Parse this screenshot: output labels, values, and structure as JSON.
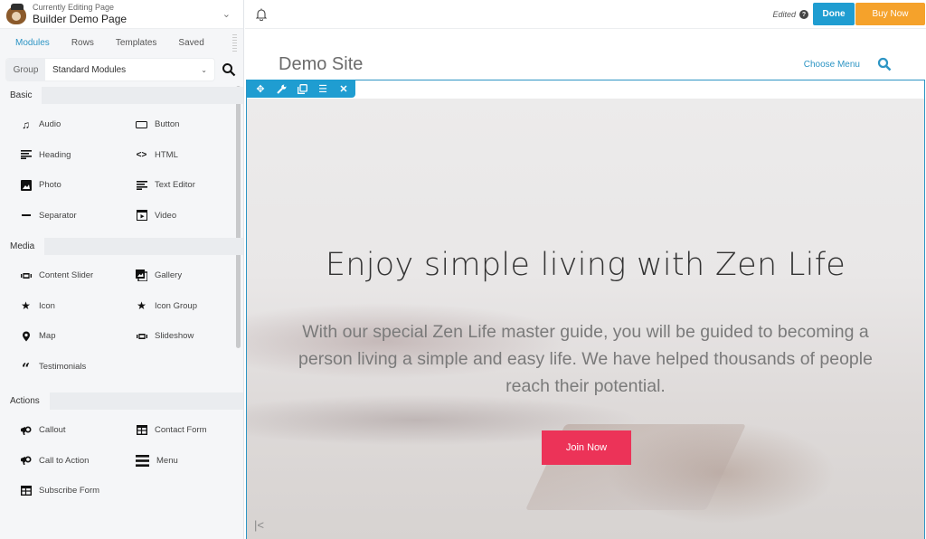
{
  "sidebar": {
    "header": {
      "subtitle": "Currently Editing Page",
      "title": "Builder Demo Page"
    },
    "tabs": [
      {
        "label": "Modules",
        "active": true
      },
      {
        "label": "Rows",
        "active": false
      },
      {
        "label": "Templates",
        "active": false
      },
      {
        "label": "Saved",
        "active": false
      }
    ],
    "group": {
      "label": "Group",
      "value": "Standard Modules"
    },
    "sections": [
      {
        "title": "Basic",
        "modules": [
          {
            "label": "Audio",
            "icon": "music-note-icon"
          },
          {
            "label": "Button",
            "icon": "button-icon"
          },
          {
            "label": "Heading",
            "icon": "heading-icon"
          },
          {
            "label": "HTML",
            "icon": "code-icon"
          },
          {
            "label": "Photo",
            "icon": "photo-icon"
          },
          {
            "label": "Text Editor",
            "icon": "text-editor-icon"
          },
          {
            "label": "Separator",
            "icon": "separator-icon"
          },
          {
            "label": "Video",
            "icon": "video-icon"
          }
        ]
      },
      {
        "title": "Media",
        "modules": [
          {
            "label": "Content Slider",
            "icon": "slider-icon"
          },
          {
            "label": "Gallery",
            "icon": "gallery-icon"
          },
          {
            "label": "Icon",
            "icon": "star-icon"
          },
          {
            "label": "Icon Group",
            "icon": "star-icon"
          },
          {
            "label": "Map",
            "icon": "map-pin-icon"
          },
          {
            "label": "Slideshow",
            "icon": "slider-icon"
          },
          {
            "label": "Testimonials",
            "icon": "quote-icon"
          }
        ]
      },
      {
        "title": "Actions",
        "modules": [
          {
            "label": "Callout",
            "icon": "megaphone-icon"
          },
          {
            "label": "Contact Form",
            "icon": "form-icon"
          },
          {
            "label": "Call to Action",
            "icon": "megaphone-icon"
          },
          {
            "label": "Menu",
            "icon": "menu-icon"
          },
          {
            "label": "Subscribe Form",
            "icon": "form-icon"
          }
        ]
      }
    ]
  },
  "topbar": {
    "status": "Edited",
    "done_label": "Done",
    "buy_label": "Buy Now"
  },
  "site": {
    "title": "Demo Site",
    "menu_label": "Choose Menu"
  },
  "hero": {
    "heading": "Enjoy simple living with Zen Life",
    "body": "With our special Zen Life master guide, you will be guided to becoming a person living a simple and easy life. We have helped thousands of people reach their potential.",
    "button_label": "Join Now"
  },
  "colors": {
    "accent": "#1f9dd1",
    "buy": "#f5a22b",
    "cta": "#ec3358",
    "link": "#2d95c4"
  }
}
